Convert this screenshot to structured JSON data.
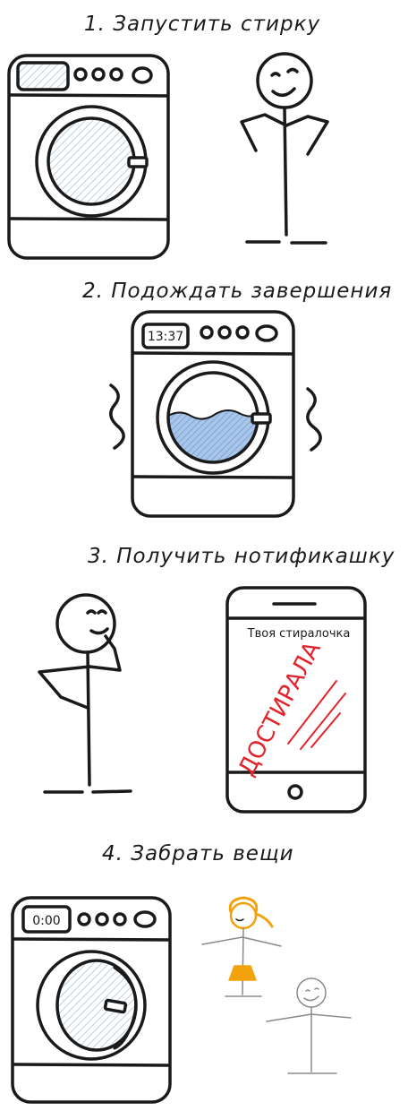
{
  "steps": [
    {
      "title": "1. Запустить стирку"
    },
    {
      "title": "2. Подождать завершения",
      "timer": "13:37"
    },
    {
      "title": "3. Получить нотификашку",
      "phone": {
        "header": "Твоя стиралочка",
        "message": "ДОСТИРАЛА"
      }
    },
    {
      "title": "4. Забрать вещи",
      "timer": "0:00"
    }
  ],
  "colors": {
    "ink": "#1a1a1a",
    "window_hatch": "#b9cfe0",
    "water": "#8fb3dd",
    "alert": "#e1242b",
    "dress": "#f2a20c",
    "figure_thin": "#8a8a8a"
  }
}
